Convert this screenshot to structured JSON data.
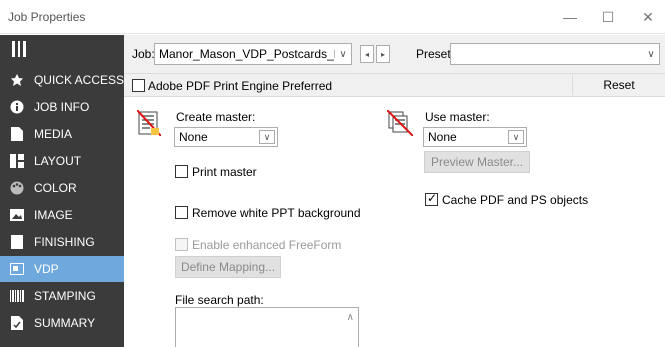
{
  "window": {
    "title": "Job Properties",
    "minimize": "—",
    "maximize": "☐",
    "close": "✕"
  },
  "sidebar": {
    "items": [
      {
        "label": "QUICK ACCESS",
        "icon": "star-icon"
      },
      {
        "label": "JOB INFO",
        "icon": "info-icon"
      },
      {
        "label": "MEDIA",
        "icon": "document-icon"
      },
      {
        "label": "LAYOUT",
        "icon": "layout-icon"
      },
      {
        "label": "COLOR",
        "icon": "palette-icon"
      },
      {
        "label": "IMAGE",
        "icon": "image-icon"
      },
      {
        "label": "FINISHING",
        "icon": "finishing-icon"
      },
      {
        "label": "VDP",
        "icon": "vdp-icon",
        "active": true
      },
      {
        "label": "STAMPING",
        "icon": "barcode-icon"
      },
      {
        "label": "SUMMARY",
        "icon": "summary-icon"
      }
    ],
    "active_color": "#6fa8dc",
    "bg_color": "#3b3b3b"
  },
  "toolbar": {
    "job_label": "Job:",
    "job_value": "Manor_Mason_VDP_Postcards_PDF",
    "presets_label": "Presets:",
    "presets_value": "",
    "prev": "◂",
    "next": "▸",
    "chevron": "∨"
  },
  "options_bar": {
    "adobe_label": "Adobe PDF Print Engine Preferred",
    "adobe_checked": false,
    "reset_label": "Reset"
  },
  "vdp": {
    "create_master_label": "Create master:",
    "create_master_value": "None",
    "use_master_label": "Use master:",
    "use_master_value": "None",
    "preview_master_label": "Preview Master...",
    "print_master_label": "Print master",
    "print_master_checked": false,
    "cache_label": "Cache PDF and PS objects",
    "cache_checked": true,
    "remove_white_label": "Remove white PPT background",
    "remove_white_checked": false,
    "enhanced_freeform_label": "Enable enhanced FreeForm",
    "enhanced_freeform_checked": false,
    "define_mapping_label": "Define Mapping...",
    "file_search_label": "File search path:",
    "file_search_value": ""
  }
}
